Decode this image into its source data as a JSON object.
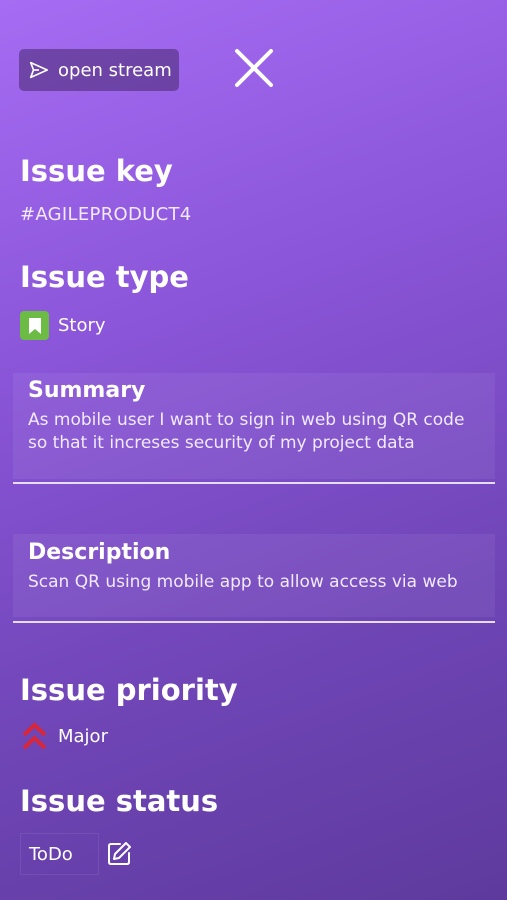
{
  "toolbar": {
    "open_stream_label": "open stream",
    "open_stream_icon": "send-icon",
    "close_icon": "close-icon"
  },
  "issue_key": {
    "heading": "Issue key",
    "value": "#AGILEPRODUCT4"
  },
  "issue_type": {
    "heading": "Issue type",
    "value": "Story",
    "icon": "bookmark-icon",
    "icon_color": "#6bbb45"
  },
  "summary": {
    "title": "Summary",
    "text_line1": "As mobile user I want to sign in web using QR code",
    "text_line2": "so that it increses security of my project data"
  },
  "description": {
    "title": "Description",
    "text": "Scan QR using mobile app to allow access via web"
  },
  "issue_priority": {
    "heading": "Issue priority",
    "value": "Major",
    "icon": "double-chevron-up-icon",
    "icon_color": "#d8263a"
  },
  "issue_status": {
    "heading": "Issue status",
    "value": "ToDo",
    "edit_icon": "edit-icon"
  }
}
